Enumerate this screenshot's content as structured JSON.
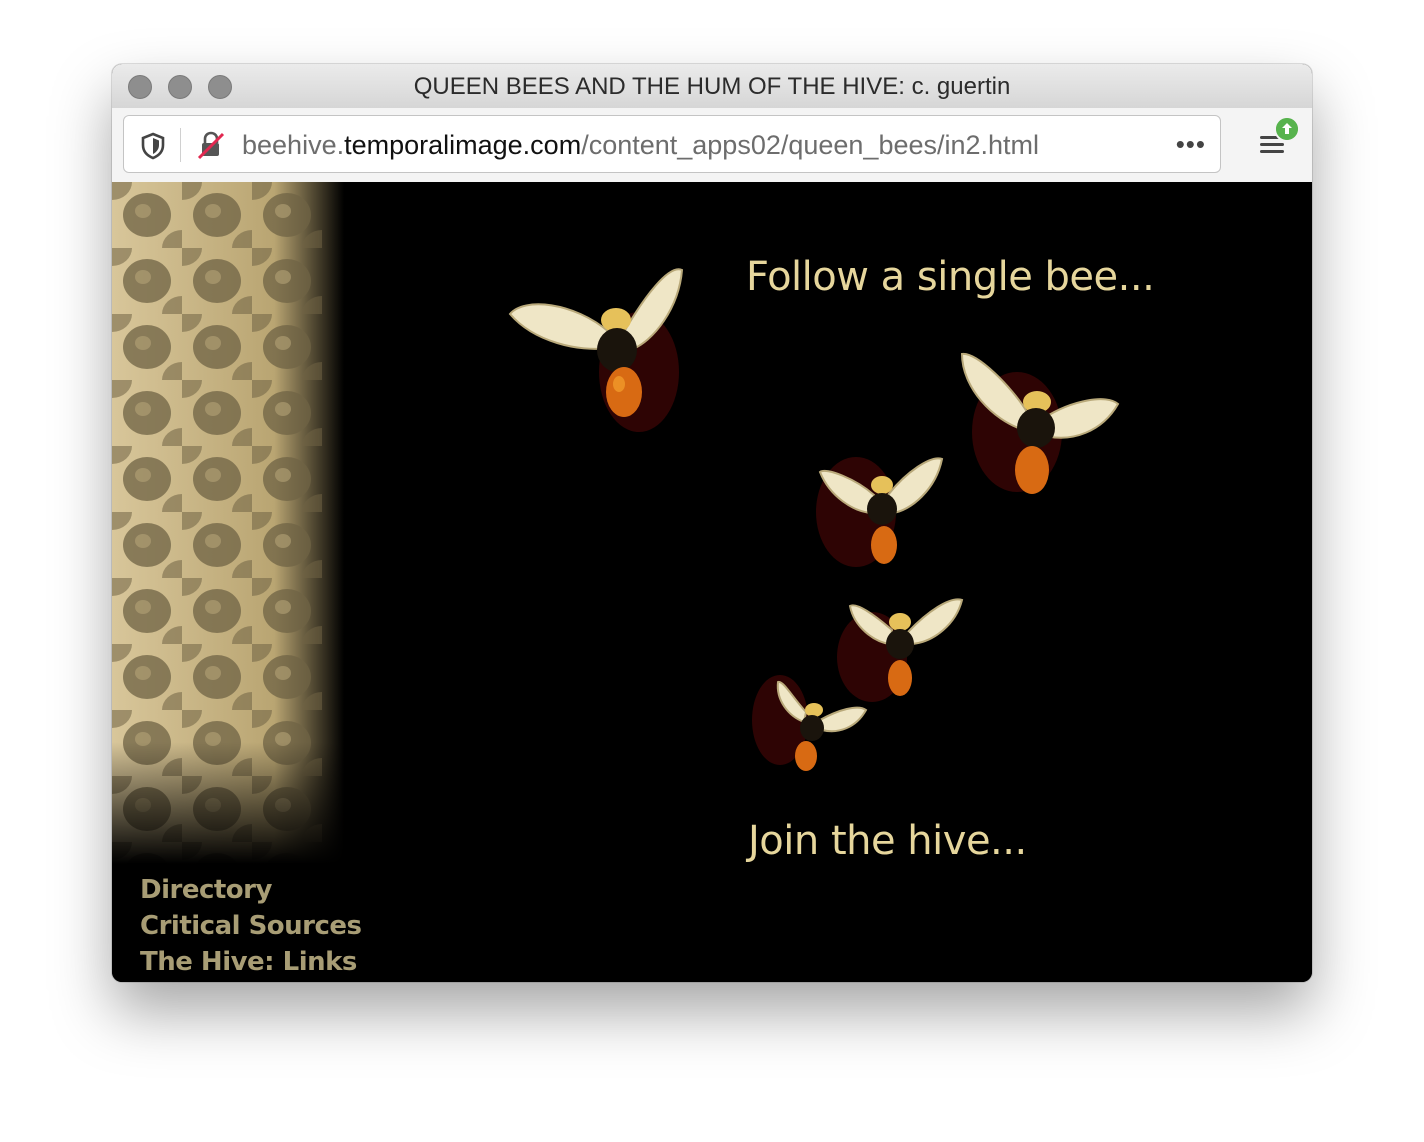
{
  "window": {
    "title": "QUEEN BEES AND THE HUM OF THE HIVE: c. guertin"
  },
  "address_bar": {
    "url_prefix": "beehive.",
    "url_domain": "temporalimage.com",
    "url_path": "/content_apps02/queen_bees/in2.html"
  },
  "toolbar": {
    "more_label": "•••"
  },
  "page": {
    "heading_top": "Follow a single bee...",
    "heading_bottom": "Join the hive...",
    "nav": [
      "Directory",
      "Critical Sources",
      "The Hive: Links"
    ]
  },
  "colors": {
    "page_bg": "#000000",
    "heading": "#e6d69c",
    "nav_text": "#a89d75",
    "honeycomb": "#c8b37f"
  }
}
